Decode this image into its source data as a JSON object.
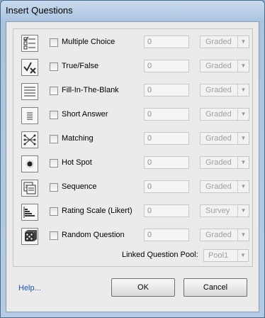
{
  "window": {
    "title": "Insert Questions"
  },
  "questions": [
    {
      "icon": "multiple-choice-icon",
      "label": "Multiple Choice",
      "count": "0",
      "grading": "Graded"
    },
    {
      "icon": "true-false-icon",
      "label": "True/False",
      "count": "0",
      "grading": "Graded"
    },
    {
      "icon": "fill-in-the-blank-icon",
      "label": "Fill-In-The-Blank",
      "count": "0",
      "grading": "Graded"
    },
    {
      "icon": "short-answer-icon",
      "label": "Short Answer",
      "count": "0",
      "grading": "Graded"
    },
    {
      "icon": "matching-icon",
      "label": "Matching",
      "count": "0",
      "grading": "Graded"
    },
    {
      "icon": "hot-spot-icon",
      "label": "Hot Spot",
      "count": "0",
      "grading": "Graded"
    },
    {
      "icon": "sequence-icon",
      "label": "Sequence",
      "count": "0",
      "grading": "Graded"
    },
    {
      "icon": "rating-scale-icon",
      "label": "Rating Scale (Likert)",
      "count": "0",
      "grading": "Survey"
    },
    {
      "icon": "random-question-icon",
      "label": "Random Question",
      "count": "0",
      "grading": "Graded"
    }
  ],
  "linked_pool": {
    "label": "Linked Question Pool:",
    "value": "Pool1"
  },
  "footer": {
    "help": "Help...",
    "ok": "OK",
    "cancel": "Cancel"
  },
  "colors": {
    "link": "#1a55b3",
    "title_bar": "#b5cbe3",
    "disabled_text": "#a0a0a0"
  }
}
